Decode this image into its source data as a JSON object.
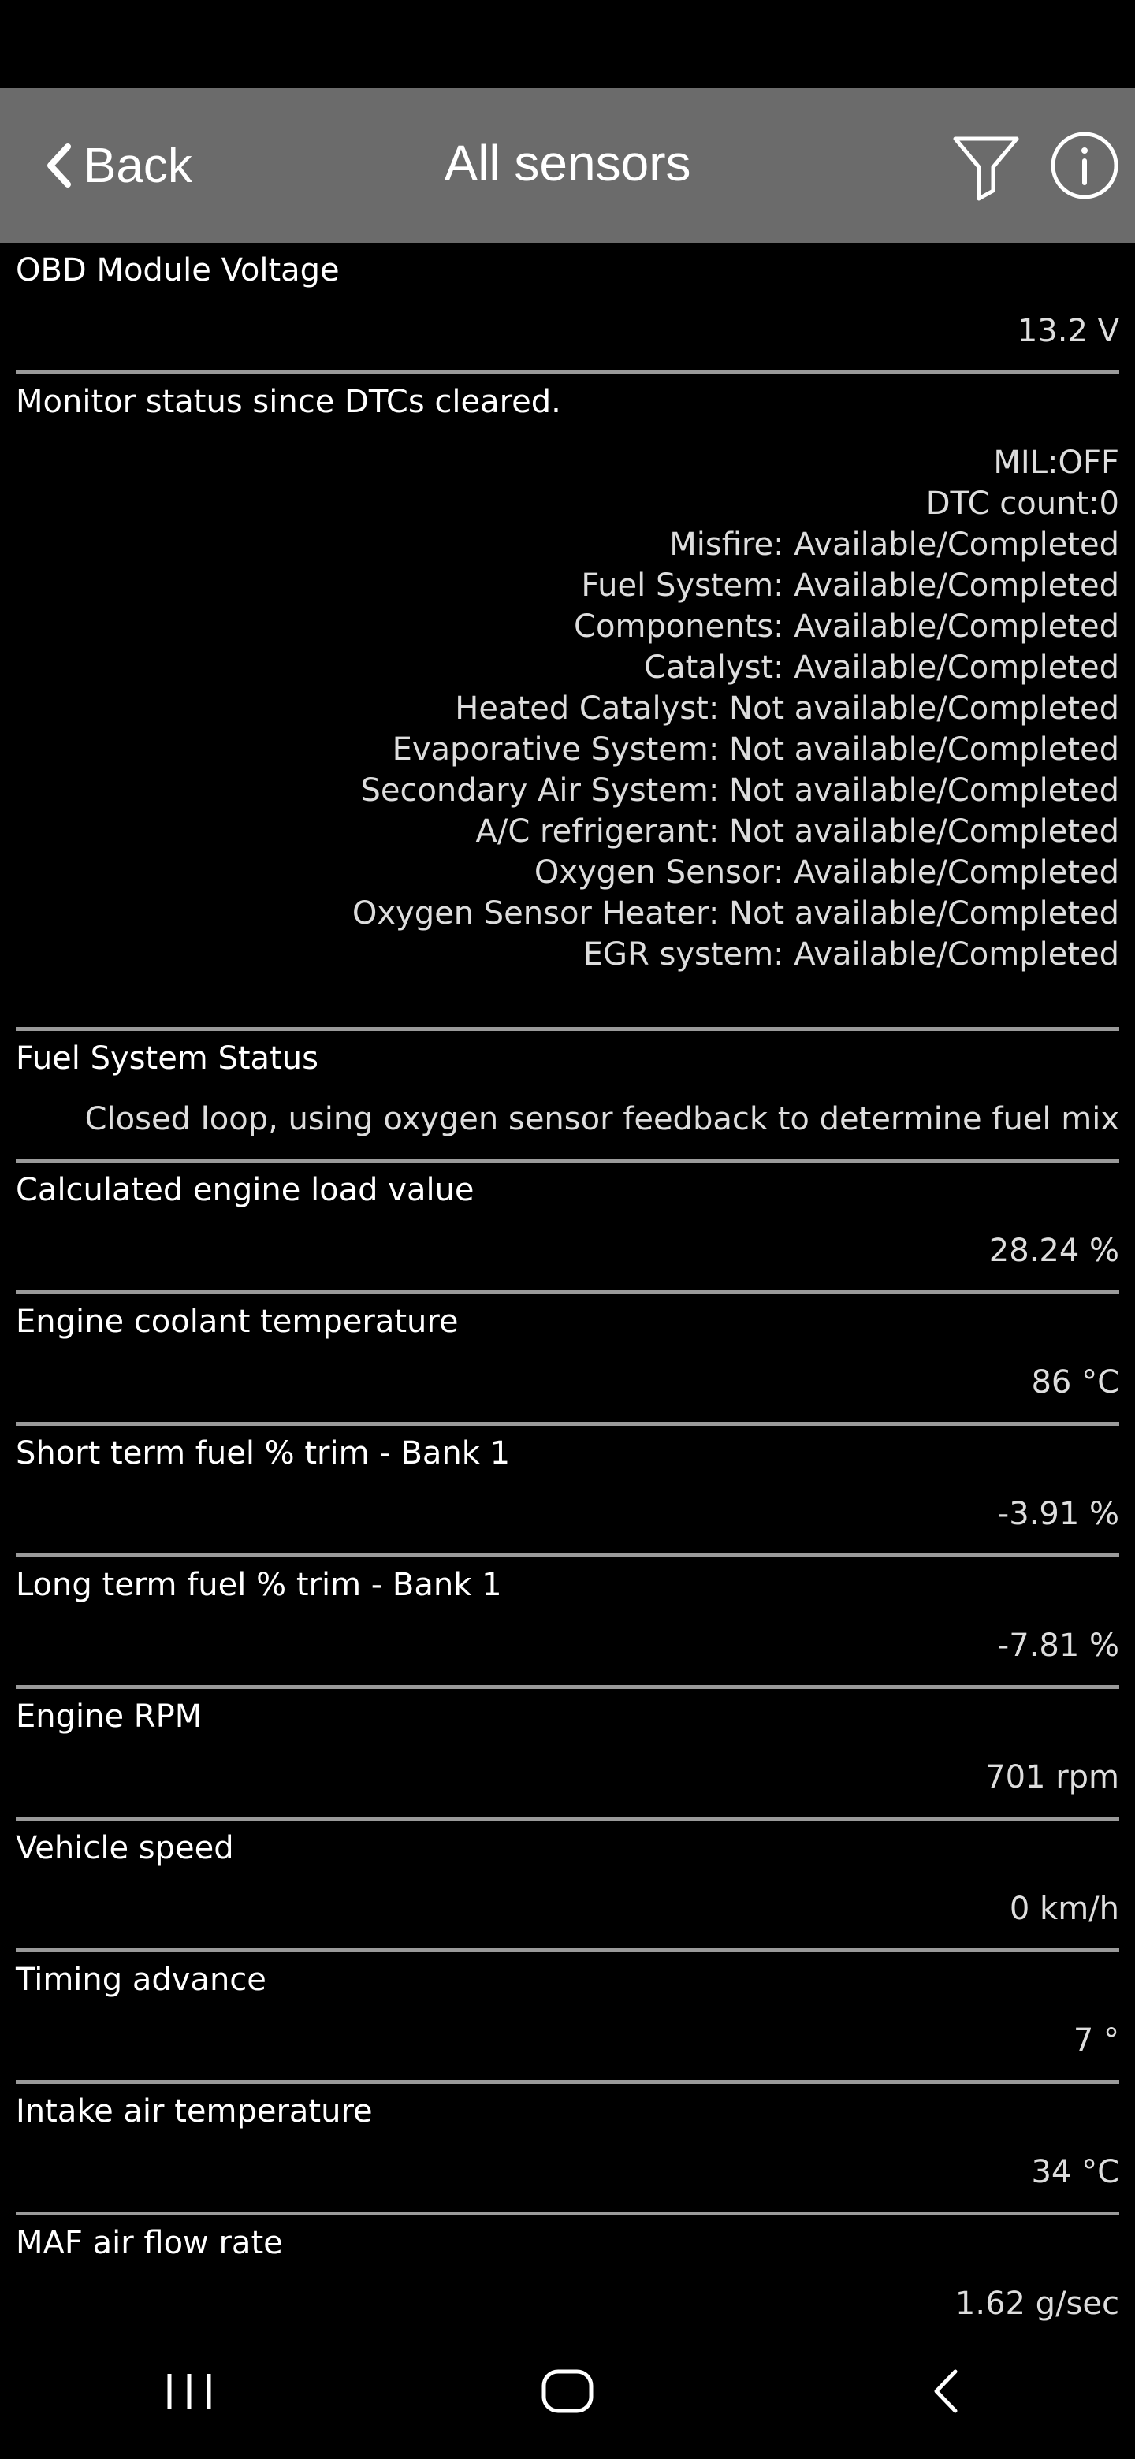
{
  "header": {
    "back_label": "Back",
    "title": "All sensors"
  },
  "icons": {
    "back": "chevron-left-icon",
    "filter": "filter-icon",
    "info": "info-icon",
    "recents": "recent-apps-icon",
    "home": "home-icon",
    "nav_back": "nav-back-icon"
  },
  "sensors": [
    {
      "name": "OBD Module Voltage",
      "value": "13.2 V"
    },
    {
      "name": "Monitor status since DTCs cleared.",
      "lines": [
        "MIL:OFF",
        "DTC count:0",
        "Misfire: Available/Completed",
        "Fuel System: Available/Completed",
        "Components: Available/Completed",
        "Catalyst: Available/Completed",
        "Heated Catalyst: Not available/Completed",
        "Evaporative System: Not available/Completed",
        "Secondary Air System: Not available/Completed",
        "A/C refrigerant: Not available/Completed",
        "Oxygen Sensor: Available/Completed",
        "Oxygen Sensor Heater: Not available/Completed",
        "EGR system: Available/Completed"
      ]
    },
    {
      "name": "Fuel System Status",
      "value": "Closed loop, using oxygen sensor feedback to determine fuel mix"
    },
    {
      "name": "Calculated engine load value",
      "value": "28.24 %"
    },
    {
      "name": "Engine coolant temperature",
      "value": "86 °C"
    },
    {
      "name": "Short term fuel % trim - Bank 1",
      "value": "-3.91 %"
    },
    {
      "name": "Long term fuel % trim - Bank 1",
      "value": "-7.81 %"
    },
    {
      "name": "Engine RPM",
      "value": "701 rpm"
    },
    {
      "name": "Vehicle speed",
      "value": "0 km/h"
    },
    {
      "name": "Timing advance",
      "value": "7 °"
    },
    {
      "name": "Intake air temperature",
      "value": "34 °C"
    },
    {
      "name": "MAF air flow rate",
      "value": "1.62 g/sec"
    }
  ]
}
